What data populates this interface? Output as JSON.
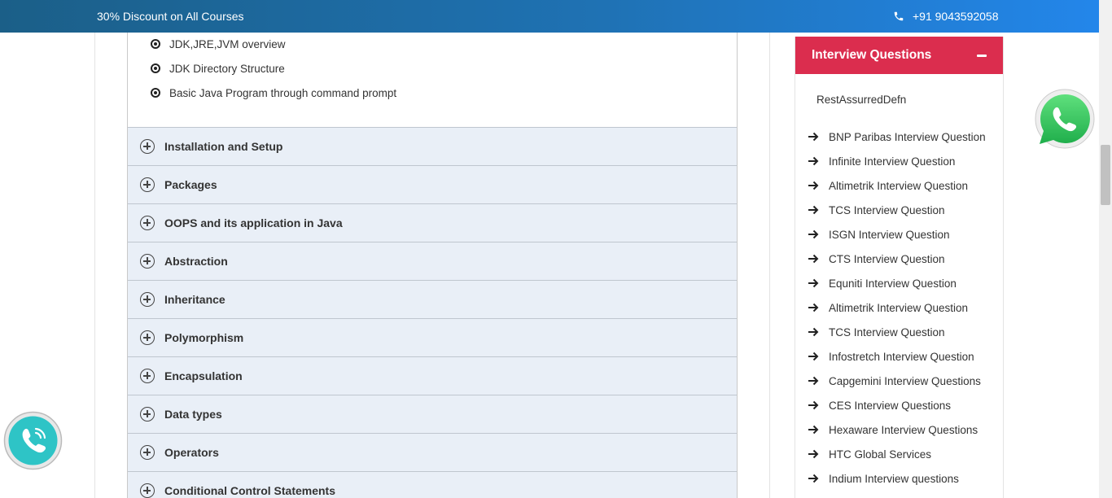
{
  "topbar": {
    "promo": "30% Discount on All Courses",
    "phone": "+91 9043592058",
    "phone_icon": "phone-icon"
  },
  "course": {
    "open_section_items": [
      "JDK,JRE,JVM overview",
      "JDK Directory Structure",
      "Basic Java Program through command prompt"
    ],
    "sections": [
      "Installation and Setup",
      "Packages",
      "OOPS and its application in Java",
      "Abstraction",
      "Inheritance",
      "Polymorphism",
      "Encapsulation",
      "Data types",
      "Operators",
      "Conditional Control Statements"
    ]
  },
  "sidebar": {
    "title": "Interview Questions",
    "first_item": "RestAssurredDefn",
    "items": [
      "BNP Paribas Interview Question",
      "Infinite Interview Question",
      "Altimetrik Interview Question",
      "TCS Interview Question",
      "ISGN Interview Question",
      "CTS Interview Question",
      "Equniti Interview Question",
      "Altimetrik Interview Question",
      "TCS Interview Question",
      "Infostretch Interview Question",
      "Capgemini Interview Questions",
      "CES Interview Questions",
      "Hexaware Interview Questions",
      "HTC Global Services",
      "Indium Interview questions"
    ]
  },
  "colors": {
    "accent": "#db2d4e",
    "topbar": "#1f72b4",
    "accordion_bg": "#e9eff7",
    "whatsapp": "#25d366",
    "call": "#2ec4c6"
  },
  "icons": {
    "whatsapp": "whatsapp-icon",
    "call": "call-icon",
    "expand": "plus-circle-icon",
    "collapse": "minus-icon",
    "list_arrow": "arrow-right-icon",
    "bullet": "radio-bullet-icon"
  }
}
